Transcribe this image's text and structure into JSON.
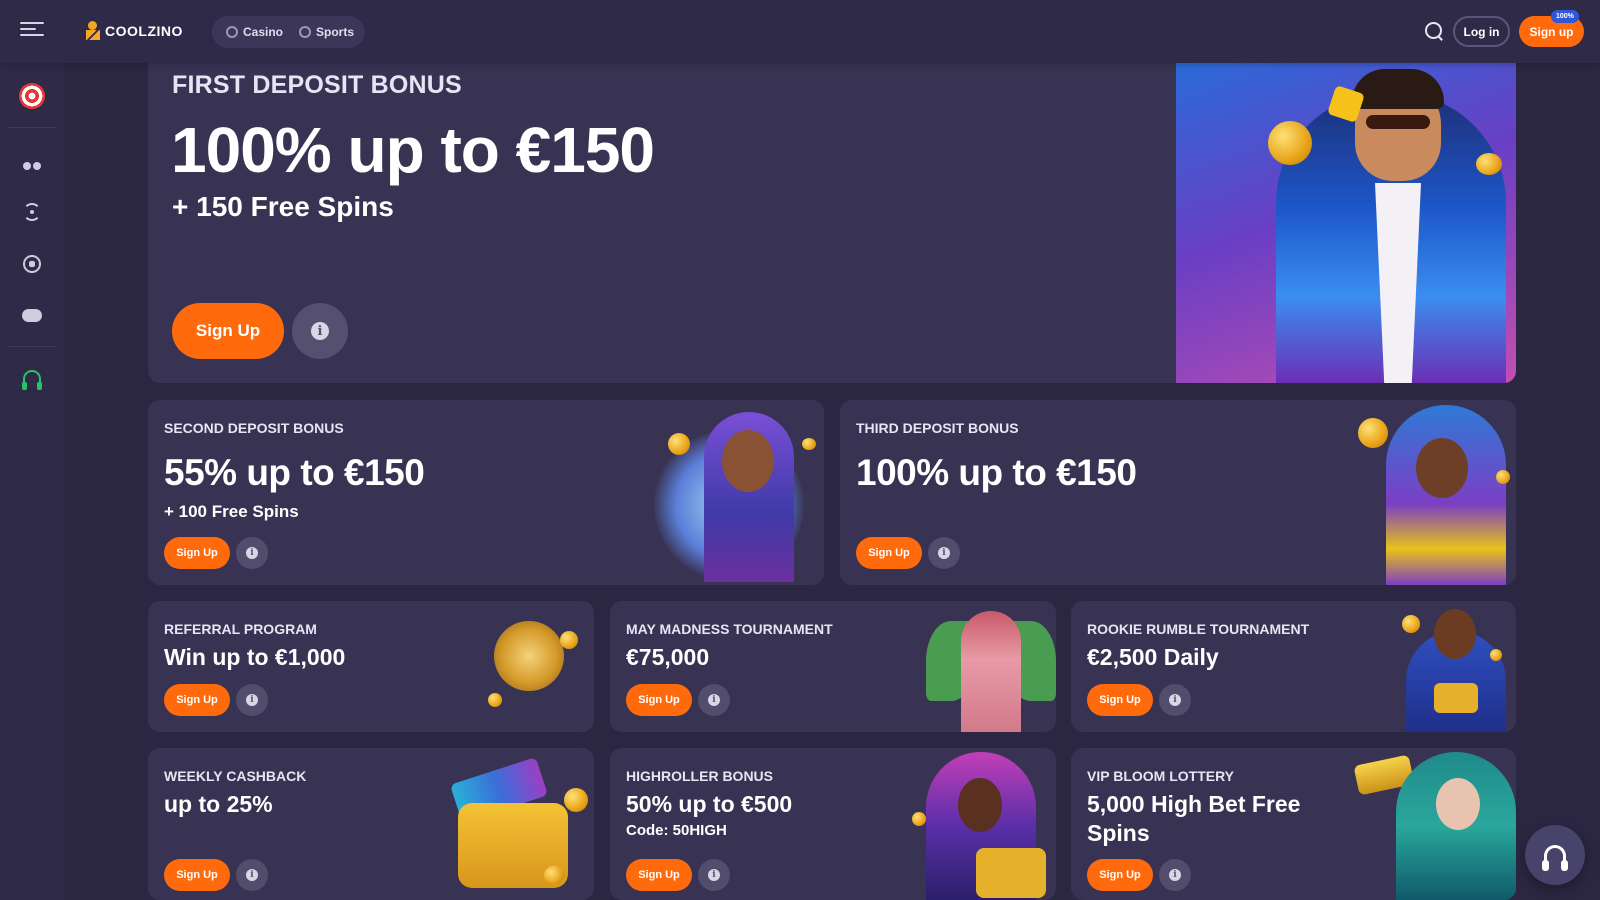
{
  "header": {
    "logo_text": "COOLZINO",
    "tabs": [
      {
        "label": "Casino",
        "icon": "cherry-icon"
      },
      {
        "label": "Sports",
        "icon": "soccer-ball-icon"
      }
    ],
    "login_label": "Log in",
    "signup_label": "Sign up",
    "signup_badge": "100%"
  },
  "sidebar": {
    "items": [
      {
        "icon": "target-darts-icon"
      },
      {
        "icon": "cherry-icon"
      },
      {
        "icon": "live-broadcast-icon"
      },
      {
        "icon": "soccer-ball-icon"
      },
      {
        "icon": "gamepad-icon"
      },
      {
        "icon": "headphones-icon"
      }
    ]
  },
  "hero": {
    "label": "FIRST DEPOSIT BONUS",
    "amount": "100% up to €150",
    "sub": "+ 150 Free Spins",
    "button": "Sign Up",
    "info": "i"
  },
  "promos_row1": [
    {
      "title": "SECOND DEPOSIT BONUS",
      "amount": "55% up to €150",
      "sub": "+ 100 Free Spins",
      "button": "Sign Up",
      "info": "i"
    },
    {
      "title": "THIRD DEPOSIT BONUS",
      "amount": "100% up to €150",
      "sub": "",
      "button": "Sign Up",
      "info": "i"
    }
  ],
  "promos_row2": [
    {
      "title": "REFERRAL PROGRAM",
      "amount": "Win up to €1,000",
      "button": "Sign Up",
      "info": "i"
    },
    {
      "title": "MAY MADNESS TOURNAMENT",
      "amount": "€75,000",
      "button": "Sign Up",
      "info": "i"
    },
    {
      "title": "ROOKIE RUMBLE TOURNAMENT",
      "amount": "€2,500 Daily",
      "button": "Sign Up",
      "info": "i"
    }
  ],
  "promos_row3": [
    {
      "title": "WEEKLY CASHBACK",
      "amount": "up to 25%",
      "code": "",
      "button": "Sign Up",
      "info": "i"
    },
    {
      "title": "HIGHROLLER BONUS",
      "amount": "50% up to €500",
      "code": "Code: 50HIGH",
      "button": "Sign Up",
      "info": "i"
    },
    {
      "title": "VIP BLOOM LOTTERY",
      "amount": "5,000 High Bet Free Spins",
      "code": "",
      "button": "Sign Up",
      "info": "i"
    }
  ],
  "colors": {
    "background": "#2b2743",
    "card": "#383353",
    "accent": "#ff6a0d",
    "badge": "#3156d8",
    "support_green": "#27c46a"
  }
}
